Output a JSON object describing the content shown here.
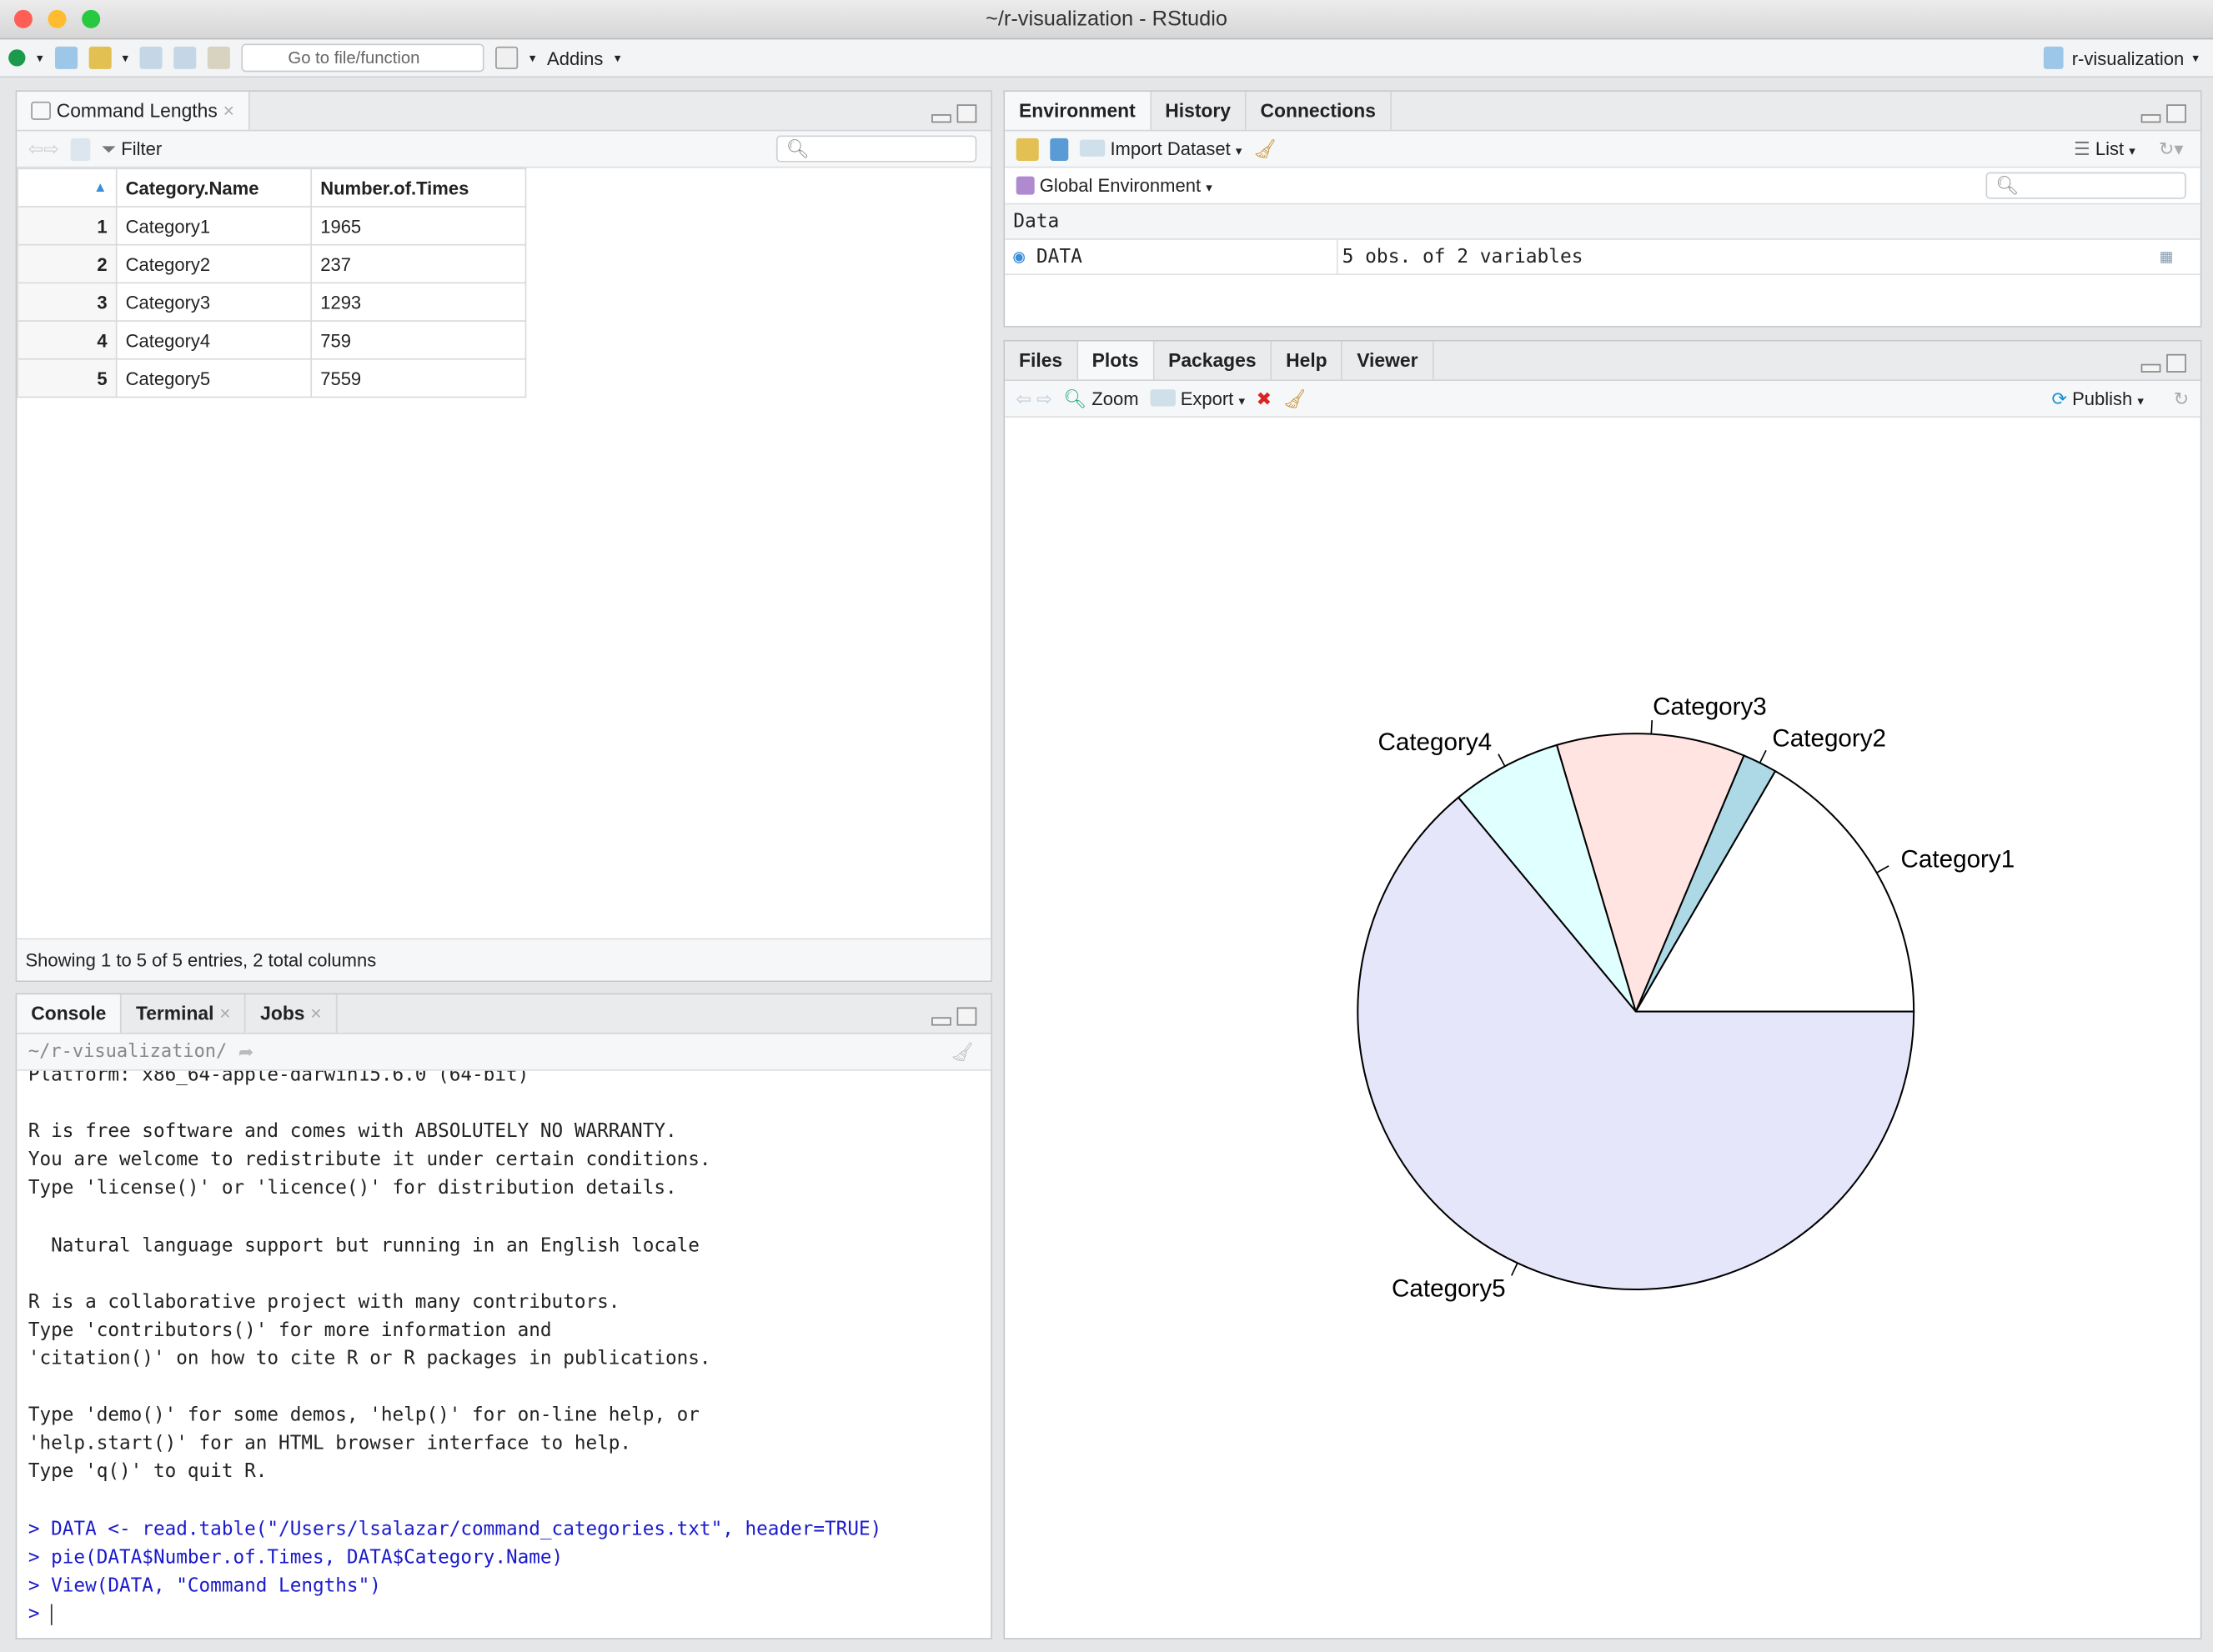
{
  "window": {
    "title": "~/r-visualization - RStudio",
    "colors": {
      "close": "#fd5f57",
      "min": "#febc2e",
      "max": "#28c840"
    }
  },
  "toolbar": {
    "goto_placeholder": "Go to file/function",
    "addins": "Addins",
    "project": "r-visualization"
  },
  "data_viewer": {
    "tab": "Command Lengths",
    "filter": "Filter",
    "columns": [
      "",
      "Category.Name",
      "Number.of.Times"
    ],
    "rows": [
      [
        "1",
        "Category1",
        "1965"
      ],
      [
        "2",
        "Category2",
        "237"
      ],
      [
        "3",
        "Category3",
        "1293"
      ],
      [
        "4",
        "Category4",
        "759"
      ],
      [
        "5",
        "Category5",
        "7559"
      ]
    ],
    "status": "Showing 1 to 5 of 5 entries, 2 total columns"
  },
  "env": {
    "tabs": [
      "Environment",
      "History",
      "Connections"
    ],
    "import": "Import Dataset",
    "list": "List",
    "scope": "Global Environment",
    "section": "Data",
    "var_name": "DATA",
    "var_value": "5 obs. of 2 variables"
  },
  "console": {
    "tabs": [
      "Console",
      "Terminal",
      "Jobs"
    ],
    "path": "~/r-visualization/",
    "lines": [
      "Platform: x86_64-apple-darwin15.6.0 (64-bit)",
      "",
      "R is free software and comes with ABSOLUTELY NO WARRANTY.",
      "You are welcome to redistribute it under certain conditions.",
      "Type 'license()' or 'licence()' for distribution details.",
      "",
      "  Natural language support but running in an English locale",
      "",
      "R is a collaborative project with many contributors.",
      "Type 'contributors()' for more information and",
      "'citation()' on how to cite R or R packages in publications.",
      "",
      "Type 'demo()' for some demos, 'help()' for on-line help, or",
      "'help.start()' for an HTML browser interface to help.",
      "Type 'q()' to quit R.",
      ""
    ],
    "commands": [
      "> DATA <- read.table(\"/Users/lsalazar/command_categories.txt\", header=TRUE)",
      "> pie(DATA$Number.of.Times, DATA$Category.Name)",
      "> View(DATA, \"Command Lengths\")"
    ],
    "prompt": ">"
  },
  "plots": {
    "tabs": [
      "Files",
      "Plots",
      "Packages",
      "Help",
      "Viewer"
    ],
    "zoom": "Zoom",
    "export": "Export",
    "publish": "Publish"
  },
  "chart_data": {
    "type": "pie",
    "categories": [
      "Category1",
      "Category2",
      "Category3",
      "Category4",
      "Category5"
    ],
    "values": [
      1965,
      237,
      1293,
      759,
      7559
    ],
    "colors": [
      "#ffffff",
      "#add8e6",
      "#ffe4e1",
      "#e0ffff",
      "#e6e6fa"
    ],
    "start_angle_deg": 0,
    "direction": "counterclockwise"
  }
}
